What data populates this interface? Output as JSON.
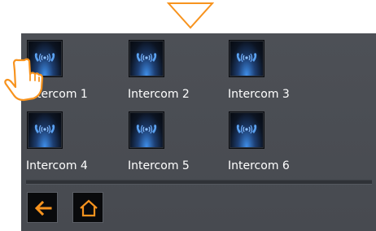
{
  "intercoms": [
    {
      "label": "Intercom 1",
      "icon": "intercom-phone-icon"
    },
    {
      "label": "Intercom 2",
      "icon": "intercom-phone-icon"
    },
    {
      "label": "Intercom 3",
      "icon": "intercom-phone-icon"
    },
    {
      "label": "Intercom 4",
      "icon": "intercom-phone-icon"
    },
    {
      "label": "Intercom 5",
      "icon": "intercom-phone-icon"
    },
    {
      "label": "Intercom 6",
      "icon": "intercom-phone-icon"
    }
  ],
  "nav": {
    "back_icon": "back-arrow-icon",
    "home_icon": "home-icon"
  },
  "colors": {
    "accent_orange": "#f7931e",
    "screen_bg": "#4b4e54",
    "icon_blue": "#4a90e8"
  }
}
